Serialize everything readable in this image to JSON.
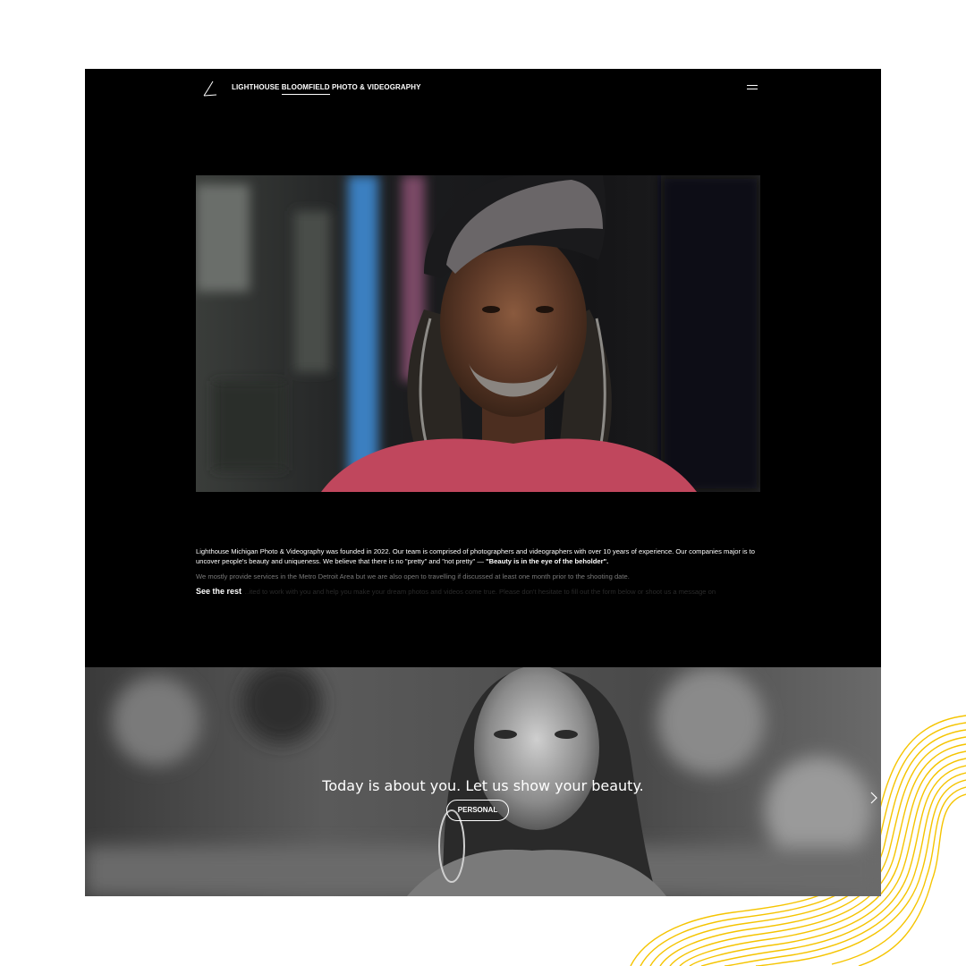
{
  "header": {
    "brand_part1": "LIGHTHOUSE ",
    "brand_highlight": "BLOOMFIELD",
    "brand_part2": " PHOTO & VIDEOGRAPHY",
    "logo_icon": "lighthouse-logo-icon",
    "menu_icon": "hamburger-menu-icon"
  },
  "hero": {
    "image": "portrait-man-cap-dreadlocks"
  },
  "about": {
    "paragraph1_a": "Lighthouse Michigan Photo & Videography was founded in 2022. Our team is comprised of photographers and videographers with over 10 years of experience. Our companies major is to uncover people's beauty and uniqueness. We believe that there is no \"pretty\" and \"not pretty\" — ",
    "paragraph1_bold": "\"Beauty is in the eye of the beholder\".",
    "paragraph2": "We mostly provide services in the Metro Detroit Area but we are also open to travelling if discussed at least one month prior to the shooting date.",
    "paragraph3_faded": "…ited to work with you and help you make your dream photos and videos come true. Please don't hesitate to fill out the form below or shoot us a message on",
    "see_rest": "See the rest"
  },
  "slider": {
    "image": "portrait-woman-black-and-white",
    "tagline": "Today is about you. Let us show your beauty.",
    "button": "PERSONAL",
    "next_icon": "chevron-right-icon"
  },
  "colors": {
    "page_bg": "#ffffff",
    "site_bg": "#000000",
    "accent_wave": "#f5c400"
  }
}
